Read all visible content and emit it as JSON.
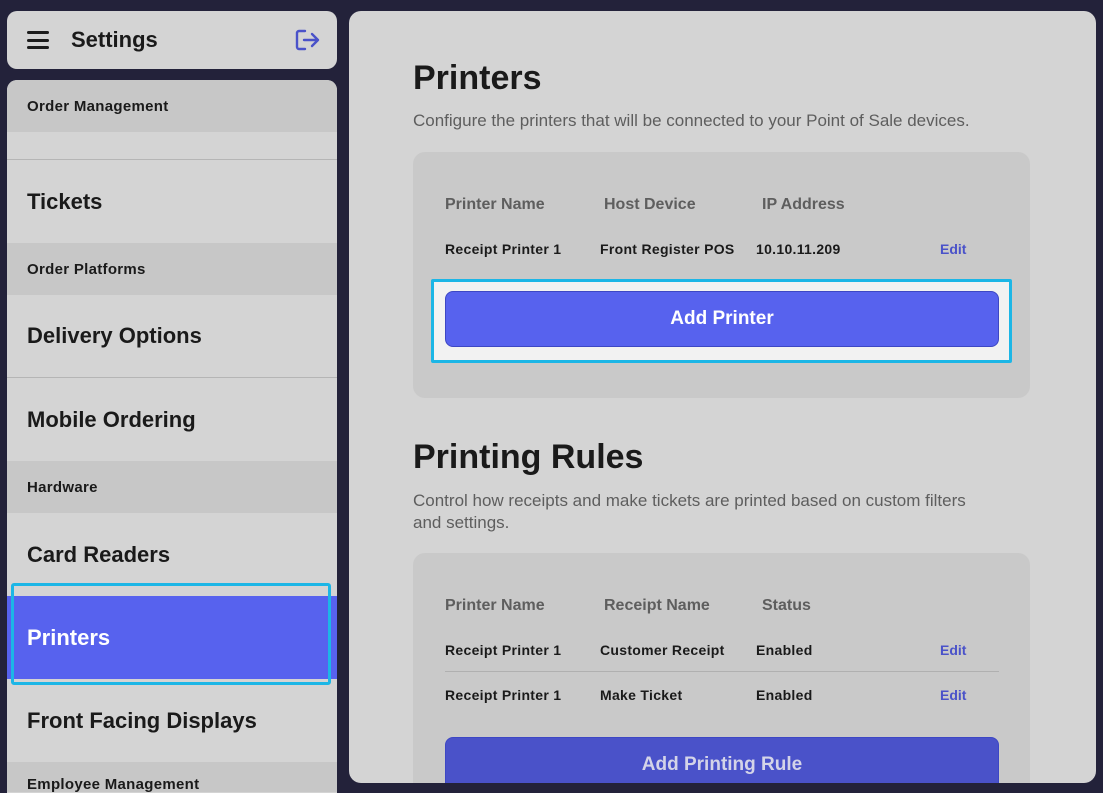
{
  "sidebar": {
    "title": "Settings",
    "sections": [
      {
        "label": "Order Management"
      },
      {
        "label": "Order Platforms"
      },
      {
        "label": "Hardware"
      },
      {
        "label": "Employee Management"
      }
    ],
    "items": [
      {
        "label": "Tickets"
      },
      {
        "label": "Delivery Options"
      },
      {
        "label": "Mobile Ordering"
      },
      {
        "label": "Card Readers"
      },
      {
        "label": "Printers",
        "active": true
      },
      {
        "label": "Front Facing Displays"
      }
    ]
  },
  "printers": {
    "title": "Printers",
    "description": "Configure the printers that will be connected to your Point of Sale devices.",
    "columns": [
      "Printer Name",
      "Host Device",
      "IP Address"
    ],
    "rows": [
      {
        "name": "Receipt Printer 1",
        "host": "Front Register POS",
        "ip": "10.10.11.209",
        "action": "Edit"
      }
    ],
    "add_label": "Add Printer"
  },
  "rules": {
    "title": "Printing Rules",
    "description_line1": "Control how receipts and make tickets are printed based on custom filters",
    "description_line2": "and settings.",
    "columns": [
      "Printer Name",
      "Receipt Name",
      "Status"
    ],
    "rows": [
      {
        "name": "Receipt Printer 1",
        "receipt": "Customer Receipt",
        "status": "Enabled",
        "action": "Edit"
      },
      {
        "name": "Receipt Printer 1",
        "receipt": "Make Ticket",
        "status": "Enabled",
        "action": "Edit"
      }
    ],
    "add_label": "Add Printing Rule"
  },
  "colors": {
    "accent": "#5762EE",
    "highlight": "#1CB6E6",
    "background": "#23223A"
  }
}
